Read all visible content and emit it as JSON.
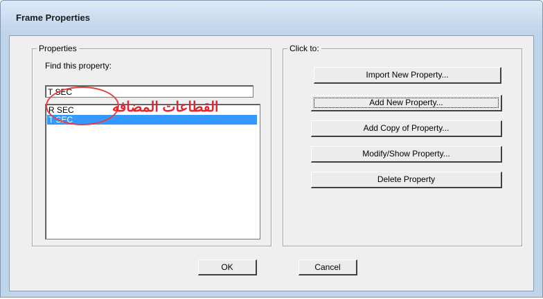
{
  "window": {
    "title": "Frame Properties"
  },
  "properties_group": {
    "legend": "Properties",
    "find_label": "Find this property:",
    "find_value": "T SEC",
    "list_items": [
      "R SEC",
      "T SEC"
    ],
    "selected_item": "T SEC"
  },
  "click_group": {
    "legend": "Click to:",
    "buttons": [
      "Import New Property...",
      "Add New Property...",
      "Add Copy of Property...",
      "Modify/Show Property...",
      "Delete Property"
    ]
  },
  "footer": {
    "ok_label": "OK",
    "cancel_label": "Cancel"
  },
  "annotation": {
    "text": "القطاعات المضافه",
    "color": "#e8232f"
  }
}
